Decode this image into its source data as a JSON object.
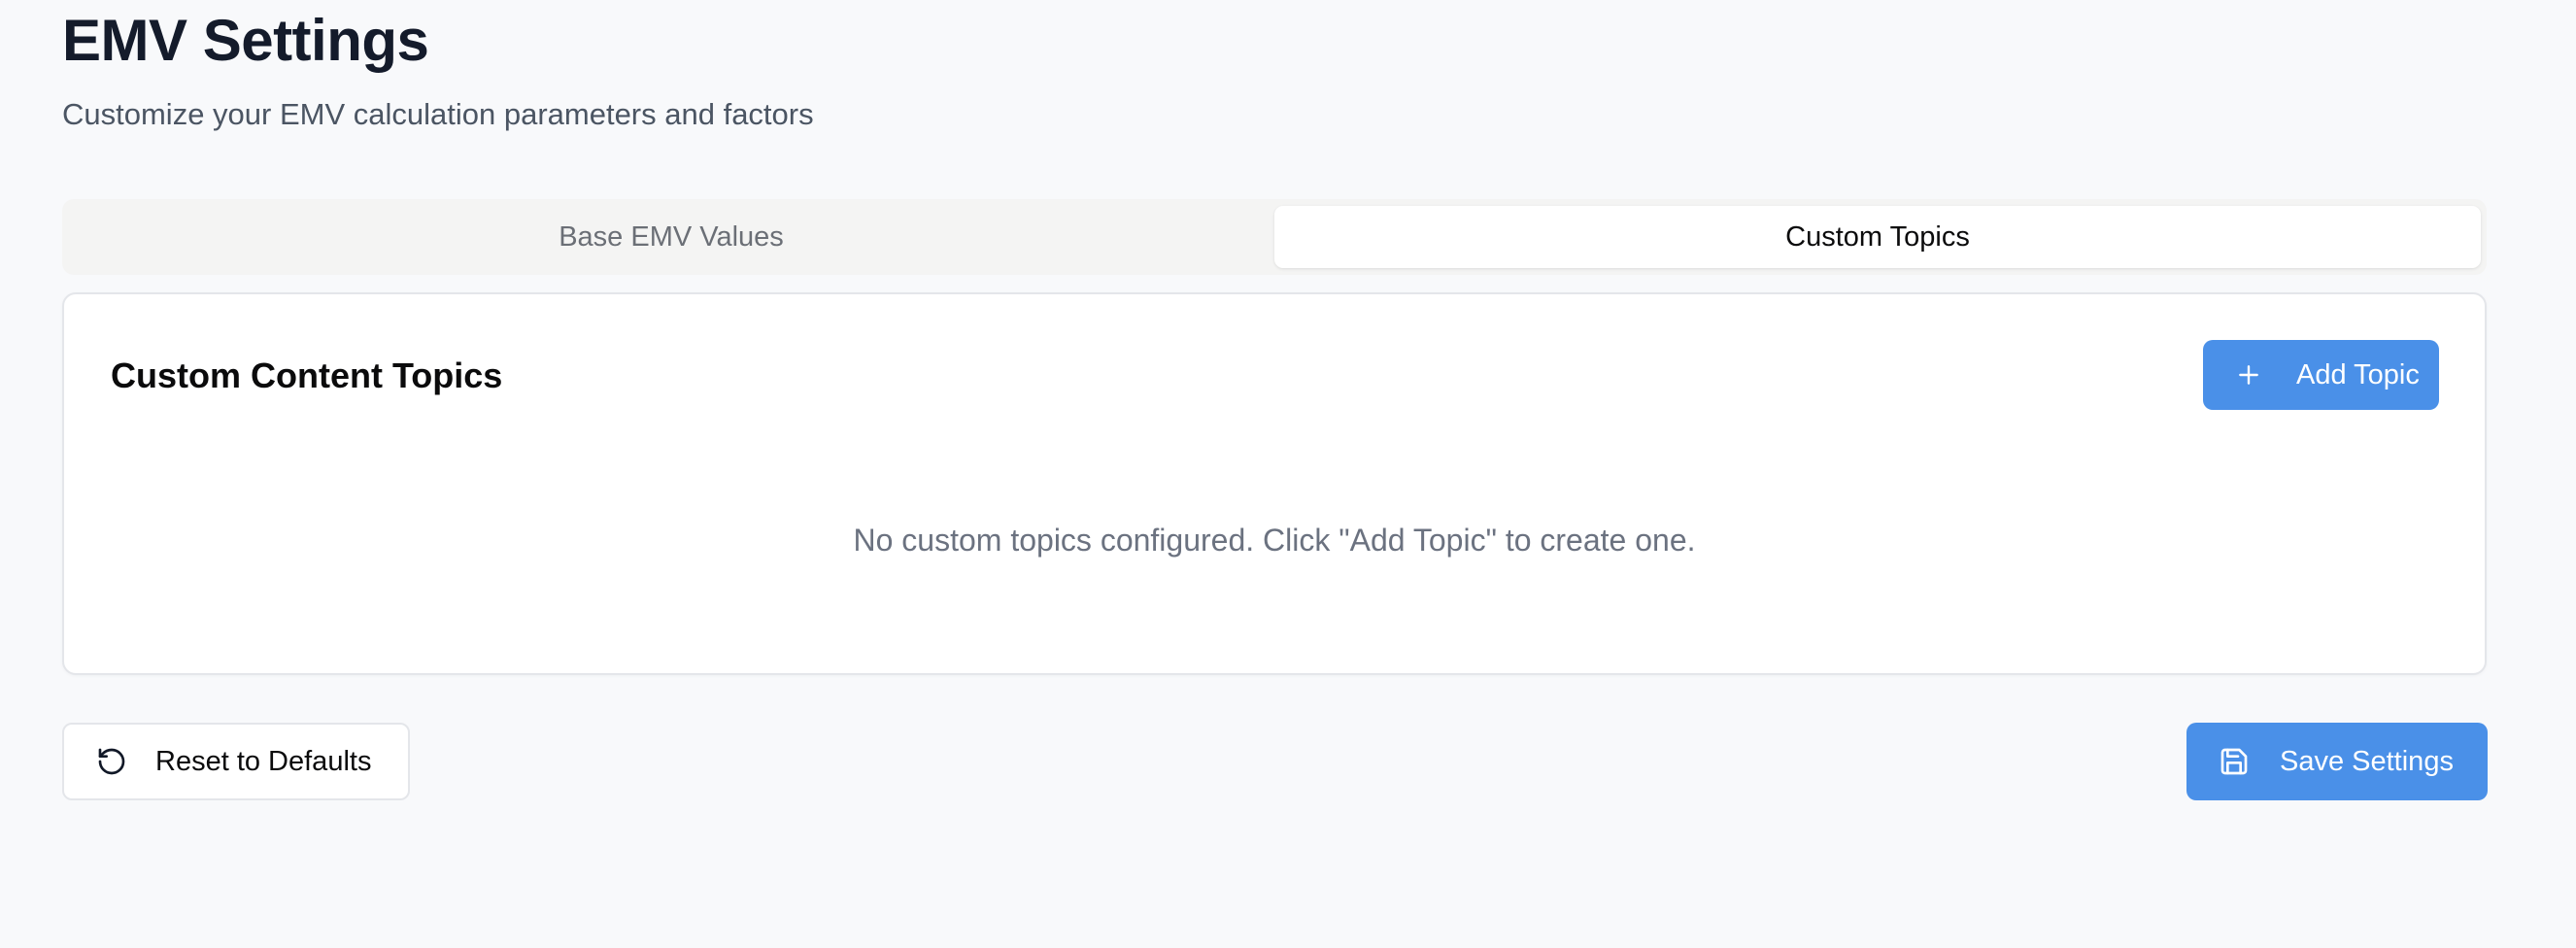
{
  "header": {
    "title": "EMV Settings",
    "subtitle": "Customize your EMV calculation parameters and factors"
  },
  "tabs": [
    {
      "label": "Base EMV Values",
      "active": false
    },
    {
      "label": "Custom Topics",
      "active": true
    }
  ],
  "custom_topics": {
    "title": "Custom Content Topics",
    "add_button_label": "Add Topic",
    "add_button_icon": "plus-icon",
    "empty_message": "No custom topics configured. Click \"Add Topic\" to create one."
  },
  "footer": {
    "reset_label": "Reset to Defaults",
    "reset_icon": "rotate-ccw-icon",
    "save_label": "Save Settings",
    "save_icon": "save-icon"
  },
  "colors": {
    "primary": "#4a90e8",
    "background": "#f8f9fb",
    "tab_track": "#f4f4f3"
  }
}
